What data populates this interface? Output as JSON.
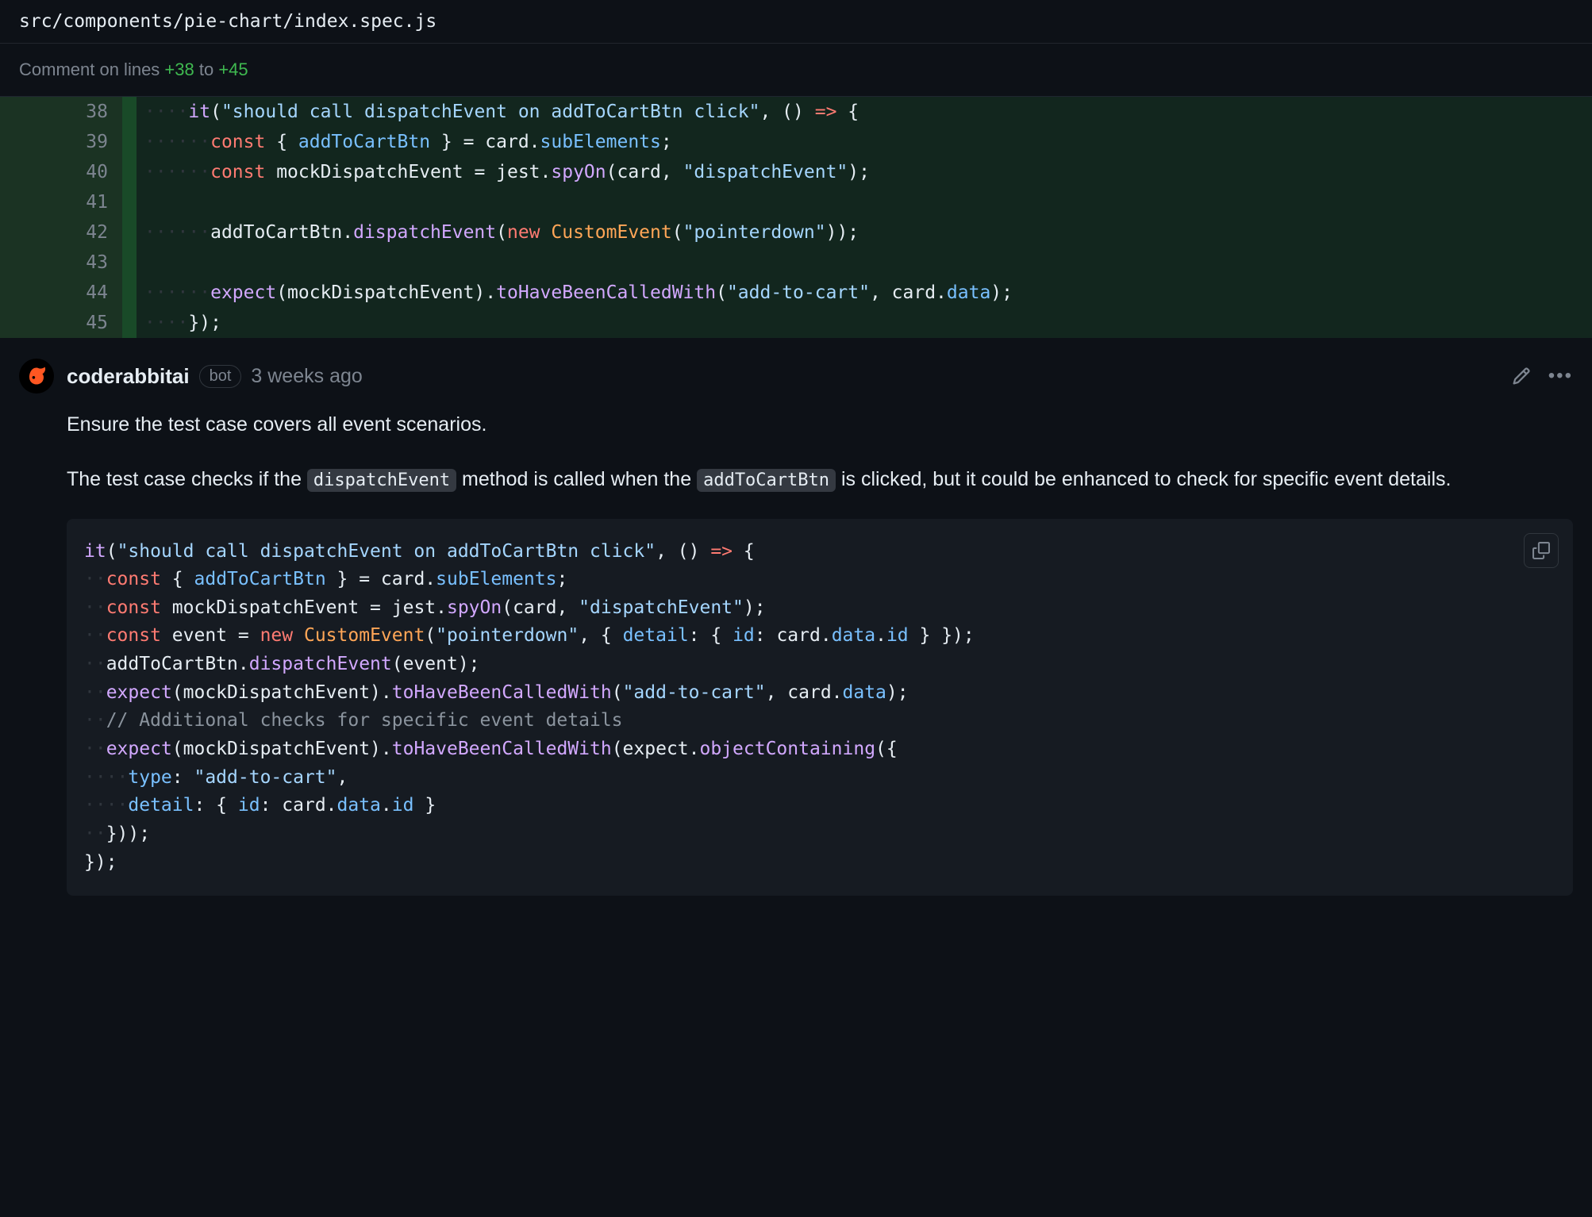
{
  "file": {
    "path": "src/components/pie-chart/index.spec.js"
  },
  "comment_range": {
    "prefix": "Comment on lines ",
    "from": "+38",
    "to_word": " to ",
    "to": "+45"
  },
  "diff": {
    "lines": [
      {
        "num": "38",
        "tokens": [
          {
            "cls": "c-ws",
            "t": "····"
          },
          {
            "cls": "c-fn",
            "t": "it"
          },
          {
            "cls": "c-op",
            "t": "("
          },
          {
            "cls": "c-str",
            "t": "\"should call dispatchEvent on addToCartBtn click\""
          },
          {
            "cls": "c-op",
            "t": ", () "
          },
          {
            "cls": "c-kw",
            "t": "=>"
          },
          {
            "cls": "c-op",
            "t": " {"
          }
        ]
      },
      {
        "num": "39",
        "tokens": [
          {
            "cls": "c-ws",
            "t": "······"
          },
          {
            "cls": "c-kw",
            "t": "const"
          },
          {
            "cls": "c-op",
            "t": " { "
          },
          {
            "cls": "c-prop",
            "t": "addToCartBtn"
          },
          {
            "cls": "c-op",
            "t": " } = card."
          },
          {
            "cls": "c-prop",
            "t": "subElements"
          },
          {
            "cls": "c-op",
            "t": ";"
          }
        ]
      },
      {
        "num": "40",
        "tokens": [
          {
            "cls": "c-ws",
            "t": "······"
          },
          {
            "cls": "c-kw",
            "t": "const"
          },
          {
            "cls": "c-id",
            "t": " mockDispatchEvent = jest."
          },
          {
            "cls": "c-fn",
            "t": "spyOn"
          },
          {
            "cls": "c-op",
            "t": "(card, "
          },
          {
            "cls": "c-str",
            "t": "\"dispatchEvent\""
          },
          {
            "cls": "c-op",
            "t": ");"
          }
        ]
      },
      {
        "num": "41",
        "tokens": []
      },
      {
        "num": "42",
        "tokens": [
          {
            "cls": "c-ws",
            "t": "······"
          },
          {
            "cls": "c-id",
            "t": "addToCartBtn."
          },
          {
            "cls": "c-fn",
            "t": "dispatchEvent"
          },
          {
            "cls": "c-op",
            "t": "("
          },
          {
            "cls": "c-kw",
            "t": "new"
          },
          {
            "cls": "c-op",
            "t": " "
          },
          {
            "cls": "c-cls",
            "t": "CustomEvent"
          },
          {
            "cls": "c-op",
            "t": "("
          },
          {
            "cls": "c-str",
            "t": "\"pointerdown\""
          },
          {
            "cls": "c-op",
            "t": "));"
          }
        ]
      },
      {
        "num": "43",
        "tokens": []
      },
      {
        "num": "44",
        "tokens": [
          {
            "cls": "c-ws",
            "t": "······"
          },
          {
            "cls": "c-fn",
            "t": "expect"
          },
          {
            "cls": "c-op",
            "t": "(mockDispatchEvent)."
          },
          {
            "cls": "c-fn",
            "t": "toHaveBeenCalledWith"
          },
          {
            "cls": "c-op",
            "t": "("
          },
          {
            "cls": "c-str",
            "t": "\"add-to-cart\""
          },
          {
            "cls": "c-op",
            "t": ", card."
          },
          {
            "cls": "c-prop",
            "t": "data"
          },
          {
            "cls": "c-op",
            "t": ");"
          }
        ]
      },
      {
        "num": "45",
        "tokens": [
          {
            "cls": "c-ws",
            "t": "····"
          },
          {
            "cls": "c-op",
            "t": "});"
          }
        ]
      }
    ]
  },
  "review": {
    "author": "coderabbitai",
    "bot_label": "bot",
    "timestamp": "3 weeks ago",
    "heading": "Ensure the test case covers all event scenarios.",
    "body_pre": "The test case checks if the ",
    "code1": "dispatchEvent",
    "body_mid": " method is called when the ",
    "code2": "addToCartBtn",
    "body_post": " is clicked, but it could be enhanced to check for specific event details.",
    "suggestion": [
      [
        {
          "cls": "c-fn",
          "t": "it"
        },
        {
          "cls": "c-op",
          "t": "("
        },
        {
          "cls": "c-str",
          "t": "\"should call dispatchEvent on addToCartBtn click\""
        },
        {
          "cls": "c-op",
          "t": ", () "
        },
        {
          "cls": "c-kw",
          "t": "=>"
        },
        {
          "cls": "c-op",
          "t": " {"
        }
      ],
      [
        {
          "cls": "c-ws",
          "t": "··"
        },
        {
          "cls": "c-kw",
          "t": "const"
        },
        {
          "cls": "c-op",
          "t": " { "
        },
        {
          "cls": "c-prop",
          "t": "addToCartBtn"
        },
        {
          "cls": "c-op",
          "t": " } = card."
        },
        {
          "cls": "c-prop",
          "t": "subElements"
        },
        {
          "cls": "c-op",
          "t": ";"
        }
      ],
      [
        {
          "cls": "c-ws",
          "t": "··"
        },
        {
          "cls": "c-kw",
          "t": "const"
        },
        {
          "cls": "c-id",
          "t": " mockDispatchEvent = jest."
        },
        {
          "cls": "c-fn",
          "t": "spyOn"
        },
        {
          "cls": "c-op",
          "t": "(card, "
        },
        {
          "cls": "c-str",
          "t": "\"dispatchEvent\""
        },
        {
          "cls": "c-op",
          "t": ");"
        }
      ],
      [
        {
          "cls": "c-ws",
          "t": "··"
        },
        {
          "cls": "c-kw",
          "t": "const"
        },
        {
          "cls": "c-id",
          "t": " event = "
        },
        {
          "cls": "c-kw",
          "t": "new"
        },
        {
          "cls": "c-op",
          "t": " "
        },
        {
          "cls": "c-cls",
          "t": "CustomEvent"
        },
        {
          "cls": "c-op",
          "t": "("
        },
        {
          "cls": "c-str",
          "t": "\"pointerdown\""
        },
        {
          "cls": "c-op",
          "t": ", { "
        },
        {
          "cls": "c-prop",
          "t": "detail"
        },
        {
          "cls": "c-op",
          "t": ": { "
        },
        {
          "cls": "c-prop",
          "t": "id"
        },
        {
          "cls": "c-op",
          "t": ": card."
        },
        {
          "cls": "c-prop",
          "t": "data"
        },
        {
          "cls": "c-op",
          "t": "."
        },
        {
          "cls": "c-prop",
          "t": "id"
        },
        {
          "cls": "c-op",
          "t": " } });"
        }
      ],
      [
        {
          "cls": "c-ws",
          "t": "··"
        },
        {
          "cls": "c-id",
          "t": "addToCartBtn."
        },
        {
          "cls": "c-fn",
          "t": "dispatchEvent"
        },
        {
          "cls": "c-op",
          "t": "(event);"
        }
      ],
      [
        {
          "cls": "c-ws",
          "t": "··"
        },
        {
          "cls": "c-fn",
          "t": "expect"
        },
        {
          "cls": "c-op",
          "t": "(mockDispatchEvent)."
        },
        {
          "cls": "c-fn",
          "t": "toHaveBeenCalledWith"
        },
        {
          "cls": "c-op",
          "t": "("
        },
        {
          "cls": "c-str",
          "t": "\"add-to-cart\""
        },
        {
          "cls": "c-op",
          "t": ", card."
        },
        {
          "cls": "c-prop",
          "t": "data"
        },
        {
          "cls": "c-op",
          "t": ");"
        }
      ],
      [
        {
          "cls": "c-ws",
          "t": "··"
        },
        {
          "cls": "c-cmt",
          "t": "// Additional checks for specific event details"
        }
      ],
      [
        {
          "cls": "c-ws",
          "t": "··"
        },
        {
          "cls": "c-fn",
          "t": "expect"
        },
        {
          "cls": "c-op",
          "t": "(mockDispatchEvent)."
        },
        {
          "cls": "c-fn",
          "t": "toHaveBeenCalledWith"
        },
        {
          "cls": "c-op",
          "t": "(expect."
        },
        {
          "cls": "c-fn",
          "t": "objectContaining"
        },
        {
          "cls": "c-op",
          "t": "({"
        }
      ],
      [
        {
          "cls": "c-ws",
          "t": "····"
        },
        {
          "cls": "c-prop",
          "t": "type"
        },
        {
          "cls": "c-op",
          "t": ": "
        },
        {
          "cls": "c-str",
          "t": "\"add-to-cart\""
        },
        {
          "cls": "c-op",
          "t": ","
        }
      ],
      [
        {
          "cls": "c-ws",
          "t": "····"
        },
        {
          "cls": "c-prop",
          "t": "detail"
        },
        {
          "cls": "c-op",
          "t": ": { "
        },
        {
          "cls": "c-prop",
          "t": "id"
        },
        {
          "cls": "c-op",
          "t": ": card."
        },
        {
          "cls": "c-prop",
          "t": "data"
        },
        {
          "cls": "c-op",
          "t": "."
        },
        {
          "cls": "c-prop",
          "t": "id"
        },
        {
          "cls": "c-op",
          "t": " }"
        }
      ],
      [
        {
          "cls": "c-ws",
          "t": "··"
        },
        {
          "cls": "c-op",
          "t": "}));"
        }
      ],
      [
        {
          "cls": "c-op",
          "t": "});"
        }
      ]
    ]
  }
}
